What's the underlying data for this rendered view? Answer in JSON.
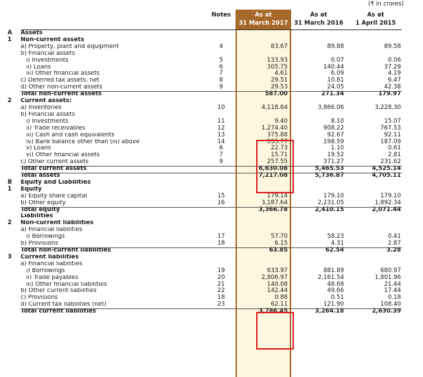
{
  "currency_note": "(₹ in crores)",
  "columns": {
    "notes": "Notes",
    "col1_line1": "As at",
    "col1_line2": "31 March 2017",
    "col2_line1": "As at",
    "col2_line2": "31 March 2016",
    "col3_line1": "As at",
    "col3_line2": "1 April 2015"
  },
  "rows": [
    {
      "code": "A",
      "label": "Assets",
      "bold": true
    },
    {
      "code": "1",
      "label": "Non-current assets",
      "bold": true
    },
    {
      "label": "a) Property, plant and equipment",
      "note": "4",
      "v1": "83.67",
      "v2": "89.88",
      "v3": "89.58"
    },
    {
      "label": "b) Financial assets"
    },
    {
      "label": "i) Investments",
      "indent": 2,
      "note": "5",
      "v1": "133.93",
      "v2": "0.07",
      "v3": "0.06"
    },
    {
      "label": "ii) Loans",
      "indent": 2,
      "note": "6",
      "v1": "305.75",
      "v2": "140.44",
      "v3": "37.29"
    },
    {
      "label": "iii) Other financial assets",
      "indent": 2,
      "note": "7",
      "v1": "4.61",
      "v2": "6.09",
      "v3": "4.19"
    },
    {
      "label": "c) Deferred tax assets, net",
      "note": "8",
      "v1": "29.51",
      "v2": "10.81",
      "v3": "6.47"
    },
    {
      "label": "d) Other non-current assets",
      "note": "9",
      "v1": "29.53",
      "v2": "24.05",
      "v3": "42.38"
    },
    {
      "label": "Total non-current assets",
      "bold": true,
      "topline": true,
      "v1": "587.00",
      "v2": "271.34",
      "v3": "179.97"
    },
    {
      "code": "2",
      "label": "Current assets:",
      "bold": true
    },
    {
      "label": "a) Inventories",
      "note": "10",
      "v1": "4,118.64",
      "v2": "3,866.06",
      "v3": "3,228.30"
    },
    {
      "label": "b) Financial assets"
    },
    {
      "label": "i) Investments",
      "indent": 2,
      "note": "11",
      "v1": "9.40",
      "v2": "8.10",
      "v3": "15.07"
    },
    {
      "label": "ii) Trade receivables",
      "indent": 2,
      "note": "12",
      "v1": "1,274.40",
      "v2": "908.22",
      "v3": "767.53"
    },
    {
      "label": "iii) Cash and cash equivalents",
      "indent": 2,
      "note": "13",
      "v1": "375.88",
      "v2": "92.67",
      "v3": "92.11"
    },
    {
      "label": "iv) Bank balance other than (iii) above",
      "indent": 2,
      "note": "14",
      "v1": "555.77",
      "v2": "198.59",
      "v3": "187.09"
    },
    {
      "label": "v) Loans",
      "indent": 2,
      "note": "6",
      "v1": "22.73",
      "v2": "1.10",
      "v3": "0.61"
    },
    {
      "label": "vi) Other financial assets",
      "indent": 2,
      "note": "7",
      "v1": "15.71",
      "v2": "19.52",
      "v3": "2.81"
    },
    {
      "label": "c) Other current assets",
      "note": "9",
      "v1": "257.55",
      "v2": "371.27",
      "v3": "231.62"
    },
    {
      "label": "Total current assets",
      "bold": true,
      "topline": true,
      "v1": "6,630.08",
      "v2": "5,465.53",
      "v3": "4,525.14"
    },
    {
      "label": "Total assets",
      "bold": true,
      "topline": true,
      "v1": "7,217.08",
      "v2": "5,736.87",
      "v3": "4,705.11"
    },
    {
      "code": "B",
      "label": "Equity and Liabilities",
      "bold": true
    },
    {
      "code": "1",
      "label": "Equity",
      "bold": true
    },
    {
      "label": "a) Equity share capital",
      "note": "15",
      "v1": "179.14",
      "v2": "179.10",
      "v3": "179.10"
    },
    {
      "label": "b) Other equity",
      "note": "16",
      "v1": "3,187.64",
      "v2": "2,231.05",
      "v3": "1,892.34"
    },
    {
      "label": "Total equity",
      "bold": true,
      "topline": true,
      "v1": "3,366.78",
      "v2": "2,410.15",
      "v3": "2,071.44"
    },
    {
      "label": "Liabilities",
      "bold": true
    },
    {
      "code": "2",
      "label": "Non-current liabilities",
      "bold": true
    },
    {
      "label": "a) Financial liabilities"
    },
    {
      "label": "i) Borrowings",
      "indent": 2,
      "note": "17",
      "v1": "57.70",
      "v2": "58.23",
      "v3": "0.41"
    },
    {
      "label": "b) Provisions",
      "note": "18",
      "v1": "6.15",
      "v2": "4.31",
      "v3": "2.87"
    },
    {
      "label": "Total non-current liabilities",
      "bold": true,
      "topline": true,
      "v1": "63.85",
      "v2": "62.54",
      "v3": "3.28"
    },
    {
      "code": "3",
      "label": "Current liabilities",
      "bold": true
    },
    {
      "label": "a) Financial liabilities"
    },
    {
      "label": "i) Borrowings",
      "indent": 2,
      "note": "19",
      "v1": "633.97",
      "v2": "881.89",
      "v3": "680.97"
    },
    {
      "label": "ii) Trade payables",
      "indent": 2,
      "note": "20",
      "v1": "2,806.97",
      "v2": "2,161.54",
      "v3": "1,801.96"
    },
    {
      "label": "iii) Other financial liabilities",
      "indent": 2,
      "note": "21",
      "v1": "140.08",
      "v2": "48.68",
      "v3": "21.44"
    },
    {
      "label": "b) Other current liabilities",
      "note": "22",
      "v1": "142.44",
      "v2": "49.66",
      "v3": "17.44"
    },
    {
      "label": "c) Provisions",
      "note": "18",
      "v1": "0.88",
      "v2": "0.51",
      "v3": "0.18"
    },
    {
      "label": "d) Current tax liabilities (net)",
      "note": "23",
      "v1": "62.11",
      "v2": "121.90",
      "v3": "108.40"
    },
    {
      "label": "Total current liabilities",
      "bold": true,
      "topline": true,
      "v1": "3,786.45",
      "v2": "3,264.18",
      "v3": "2,630.39"
    }
  ]
}
